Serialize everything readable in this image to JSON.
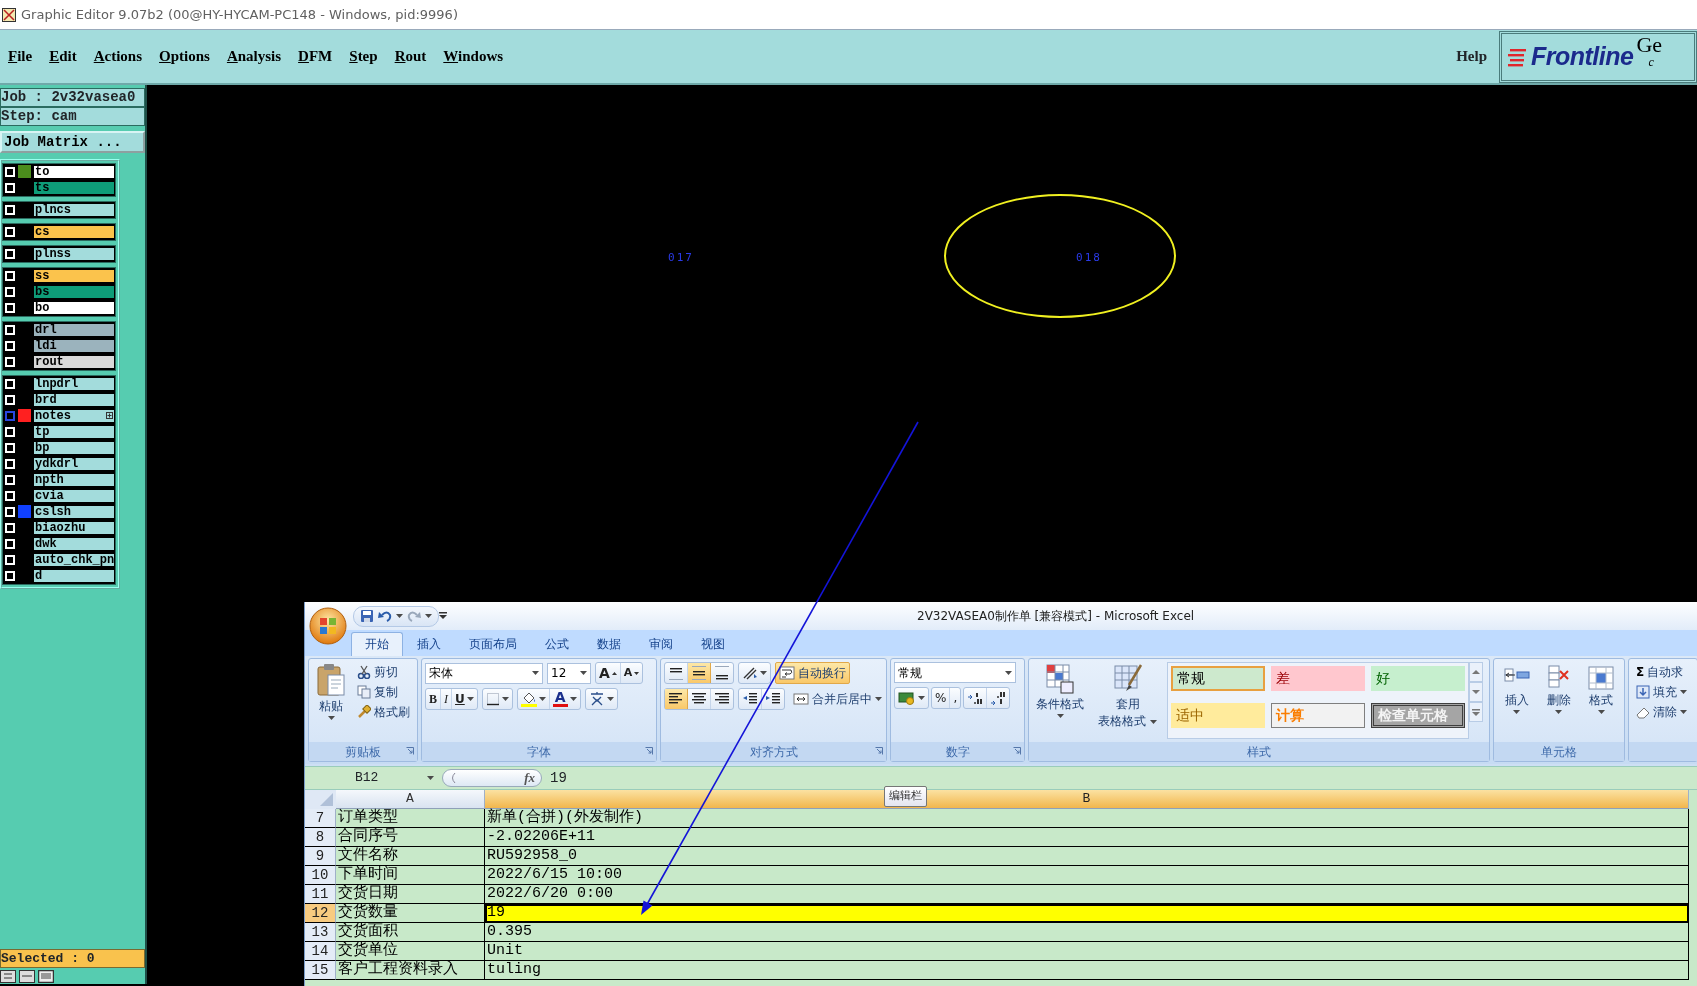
{
  "window": {
    "title": "Graphic Editor 9.07b2 (00@HY-HYCAM-PC148 - Windows, pid:9996)"
  },
  "menu": [
    "File",
    "Edit",
    "Actions",
    "Options",
    "Analysis",
    "DFM",
    "Step",
    "Rout",
    "Windows"
  ],
  "help": "Help",
  "logo": {
    "brand": "Frontline",
    "cut_text": "Ge",
    "cut_text_2": "c"
  },
  "job_panel": {
    "job": "Job : 2v32vasea0",
    "step": "Step: cam",
    "matrix_button": "Job Matrix ..."
  },
  "layer_groups": [
    {
      "layers": [
        {
          "name": "to",
          "color": "#ffffff",
          "swatch": {
            "color": "#4b8d1c"
          },
          "checked": false,
          "selected": false,
          "marker": false
        },
        {
          "name": "ts",
          "color": "#0e9c78",
          "checked": false,
          "selected": false,
          "marker": false
        }
      ]
    },
    {
      "layers": [
        {
          "name": "plncs",
          "color": "#a3dcdc",
          "checked": false,
          "selected": false,
          "marker": false
        }
      ]
    },
    {
      "layers": [
        {
          "name": "cs",
          "color": "#fbc34c",
          "checked": false,
          "selected": false,
          "marker": false
        }
      ]
    },
    {
      "layers": [
        {
          "name": "plnss",
          "color": "#a3dcdc",
          "checked": false,
          "selected": false,
          "marker": false
        }
      ]
    },
    {
      "layers": [
        {
          "name": "ss",
          "color": "#fbc34c",
          "checked": false,
          "selected": false,
          "marker": false
        },
        {
          "name": "bs",
          "color": "#0e9c78",
          "checked": false,
          "selected": false,
          "marker": false
        },
        {
          "name": "bo",
          "color": "#ffffff",
          "checked": false,
          "selected": false,
          "marker": false
        }
      ]
    },
    {
      "layers": [
        {
          "name": "drl",
          "color": "#9bb3bd",
          "checked": false,
          "selected": false,
          "marker": false
        },
        {
          "name": "ldi",
          "color": "#9bb3bd",
          "checked": false,
          "selected": false,
          "marker": false
        },
        {
          "name": "rout",
          "color": "#d9d9d9",
          "checked": false,
          "selected": false,
          "marker": false
        }
      ]
    },
    {
      "layers": [
        {
          "name": "lnpdrl",
          "color": "#a3dcdc",
          "checked": false,
          "selected": false,
          "marker": false
        },
        {
          "name": "brd",
          "color": "#a3dcdc",
          "checked": false,
          "selected": false,
          "marker": false
        },
        {
          "name": "notes",
          "color": "#a3dcdc",
          "swatch": {
            "color": "#ff2020"
          },
          "checked": false,
          "selected": true,
          "marker": true
        },
        {
          "name": "tp",
          "color": "#a3dcdc",
          "checked": false,
          "selected": false,
          "marker": false
        },
        {
          "name": "bp",
          "color": "#a3dcdc",
          "checked": false,
          "selected": false,
          "marker": false
        },
        {
          "name": "ydkdrl",
          "color": "#a3dcdc",
          "checked": false,
          "selected": false,
          "marker": false
        },
        {
          "name": "npth",
          "color": "#a3dcdc",
          "checked": false,
          "selected": false,
          "marker": false
        },
        {
          "name": "cvia",
          "color": "#a3dcdc",
          "checked": false,
          "selected": false,
          "marker": false
        },
        {
          "name": "cslsh",
          "color": "#a3dcdc",
          "swatch": {
            "color": "#1040ff"
          },
          "checked": false,
          "selected": false,
          "marker": false
        },
        {
          "name": "biaozhu",
          "color": "#a3dcdc",
          "checked": false,
          "selected": false,
          "marker": false
        },
        {
          "name": "dwk",
          "color": "#a3dcdc",
          "checked": false,
          "selected": false,
          "marker": false
        },
        {
          "name": "auto_chk_pn",
          "color": "#a3dcdc",
          "checked": false,
          "selected": false,
          "marker": false
        },
        {
          "name": "d",
          "color": "#a3dcdc",
          "checked": false,
          "selected": false,
          "marker": false
        }
      ]
    }
  ],
  "selected_count": "Selected : 0",
  "canvas": {
    "features": [
      {
        "label": "017",
        "outlined": false
      },
      {
        "label": "018",
        "outlined": true
      }
    ]
  },
  "excel": {
    "title": "2V32VASEA0制作单  [兼容模式] - Microsoft Excel",
    "tabs": [
      {
        "label": "开始",
        "selected": true
      },
      {
        "label": "插入",
        "selected": false
      },
      {
        "label": "页面布局",
        "selected": false
      },
      {
        "label": "公式",
        "selected": false
      },
      {
        "label": "数据",
        "selected": false
      },
      {
        "label": "审阅",
        "selected": false
      },
      {
        "label": "视图",
        "selected": false
      }
    ],
    "clipboard": {
      "label": "剪贴板",
      "paste": "粘贴",
      "cut": "剪切",
      "copy": "复制",
      "format_painter": "格式刷"
    },
    "font": {
      "label": "字体",
      "name": "宋体",
      "size": "12",
      "grow": "A",
      "shrink": "A",
      "bold": "B",
      "italic": "I",
      "underline": "U",
      "font_color": "A"
    },
    "alignment": {
      "label": "对齐方式",
      "vertical": [
        {
          "selected": false
        },
        {
          "selected": true
        },
        {
          "selected": false
        }
      ],
      "horizontal": [
        {
          "selected": true
        },
        {
          "selected": false
        },
        {
          "selected": false
        }
      ],
      "wrap_text": {
        "label": "自动换行",
        "on": true
      },
      "merge": "合并后居中"
    },
    "number": {
      "label": "数字",
      "format": "常规",
      "percent": "%",
      "comma": ","
    },
    "styles": {
      "label": "样式",
      "conditional": "条件格式",
      "table_format": [
        "套用",
        "表格格式"
      ],
      "gallery": [
        {
          "label": "常规",
          "kind": "normal",
          "selected": true
        },
        {
          "label": "差",
          "kind": "bad",
          "selected": false
        },
        {
          "label": "好",
          "kind": "good",
          "selected": false
        },
        {
          "label": "适中",
          "kind": "neutral",
          "selected": false
        },
        {
          "label": "计算",
          "kind": "calculation",
          "selected": false
        },
        {
          "label": "检查单元格",
          "kind": "check",
          "selected": false
        }
      ]
    },
    "cells": {
      "label": "单元格",
      "buttons": [
        {
          "label": "插入",
          "kind": "insert"
        },
        {
          "label": "删除",
          "kind": "delete"
        },
        {
          "label": "格式",
          "kind": "format"
        }
      ]
    },
    "editing": {
      "sum_symbol": "Σ",
      "autosum": "自动求",
      "fill": "填充",
      "clear": "清除"
    },
    "formula_bar": {
      "name_box": "B12",
      "function_symbol": "fx",
      "value": "19"
    },
    "tooltip": "编辑栏",
    "columns": [
      {
        "label": "A",
        "selected": false
      },
      {
        "label": "B",
        "selected": true
      }
    ],
    "rows": [
      {
        "number": "7",
        "a": "订单类型",
        "b": "新单(合拼)(外发制作)",
        "selected": false
      },
      {
        "number": "8",
        "a": "合同序号",
        "b": "-2.02206E+11",
        "selected": false
      },
      {
        "number": "9",
        "a": "文件名称",
        "b": "RU592958_0",
        "selected": false
      },
      {
        "number": "10",
        "a": "下单时间",
        "b": "2022/6/15 10:00",
        "selected": false
      },
      {
        "number": "11",
        "a": "交货日期",
        "b": "2022/6/20 0:00",
        "selected": false
      },
      {
        "number": "12",
        "a": "交货数量",
        "b": "19",
        "selected": true
      },
      {
        "number": "13",
        "a": "交货面积",
        "b": "0.395",
        "selected": false
      },
      {
        "number": "14",
        "a": "交货单位",
        "b": "Unit",
        "selected": false
      },
      {
        "number": "15",
        "a": "客户工程资料录入",
        "b": "tuling",
        "selected": false
      }
    ]
  }
}
